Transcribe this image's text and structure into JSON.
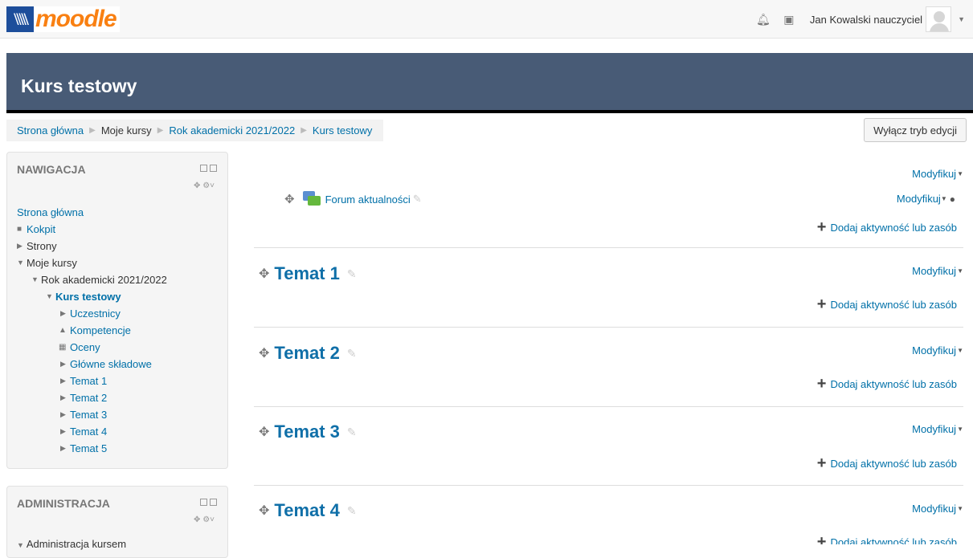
{
  "navbar": {
    "logo_mark": "\\\\\\\\\\",
    "logo_text": "moodle",
    "user_name": "Jan Kowalski nauczyciel"
  },
  "header": {
    "title": "Kurs testowy"
  },
  "breadcrumb": [
    "Strona główna",
    "Moje kursy",
    "Rok akademicki 2021/2022",
    "Kurs testowy"
  ],
  "edit_button": "Wyłącz tryb edycji",
  "nav_block": {
    "title": "NAWIGACJA",
    "items": [
      {
        "label": "Strona główna"
      },
      {
        "label": "Kokpit"
      },
      {
        "label": "Strony"
      },
      {
        "label": "Moje kursy"
      },
      {
        "label": "Rok akademicki 2021/2022"
      },
      {
        "label": "Kurs testowy"
      },
      {
        "label": "Uczestnicy"
      },
      {
        "label": "Kompetencje"
      },
      {
        "label": "Oceny"
      },
      {
        "label": "Główne składowe"
      },
      {
        "label": "Temat 1"
      },
      {
        "label": "Temat 2"
      },
      {
        "label": "Temat 3"
      },
      {
        "label": "Temat 4"
      },
      {
        "label": "Temat 5"
      }
    ]
  },
  "admin_block": {
    "title": "ADMINISTRACJA",
    "item": "Administracja kursem"
  },
  "course": {
    "modify": "Modyfikuj",
    "add_activity": "Dodaj aktywność lub zasób",
    "forum": "Forum aktualności",
    "topics": [
      "Temat 1",
      "Temat 2",
      "Temat 3",
      "Temat 4"
    ]
  },
  "icons": [
    "bell-icon",
    "chat-icon",
    "move-icon",
    "pencil-icon",
    "plus-icon",
    "user-icon",
    "forum-icon"
  ],
  "colors": {
    "header_bg": "#485b76",
    "link": "#0070a8",
    "topic": "#0f6fa8",
    "logo_orange": "#f98012"
  }
}
